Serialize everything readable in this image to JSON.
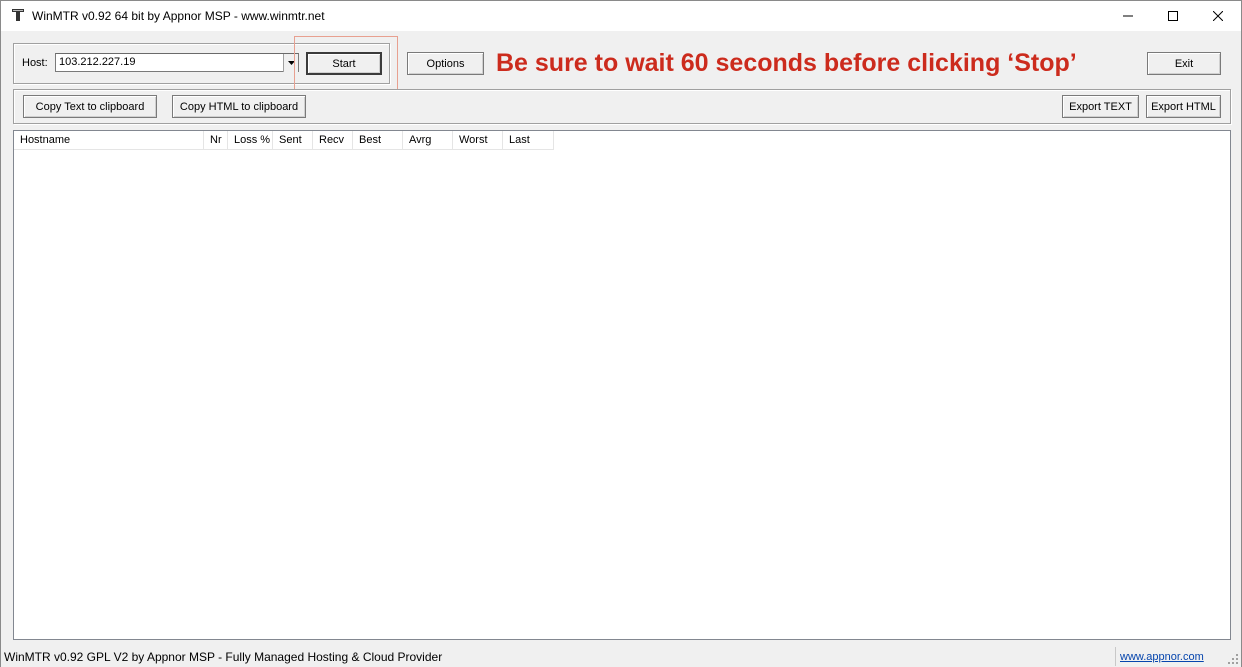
{
  "window": {
    "title": "WinMTR v0.92 64 bit by Appnor MSP - www.winmtr.net",
    "controls": {
      "minimize": "minimize-icon",
      "maximize": "maximize-icon",
      "close": "close-icon"
    }
  },
  "host_bar": {
    "host_label": "Host:",
    "host_value": "103.212.227.19",
    "start_label": "Start",
    "options_label": "Options",
    "exit_label": "Exit",
    "notice": "Be sure to wait 60 seconds before clicking ‘Stop’",
    "notice_color": "#cc2b1d"
  },
  "export_bar": {
    "copy_text_label": "Copy Text to clipboard",
    "copy_html_label": "Copy HTML to clipboard",
    "export_text_label": "Export TEXT",
    "export_html_label": "Export HTML"
  },
  "table": {
    "columns": [
      "Hostname",
      "Nr",
      "Loss %",
      "Sent",
      "Recv",
      "Best",
      "Avrg",
      "Worst",
      "Last"
    ],
    "rows": []
  },
  "statusbar": {
    "text": "WinMTR v0.92 GPL V2 by Appnor MSP - Fully Managed Hosting & Cloud Provider",
    "link": "www.appnor.com"
  }
}
